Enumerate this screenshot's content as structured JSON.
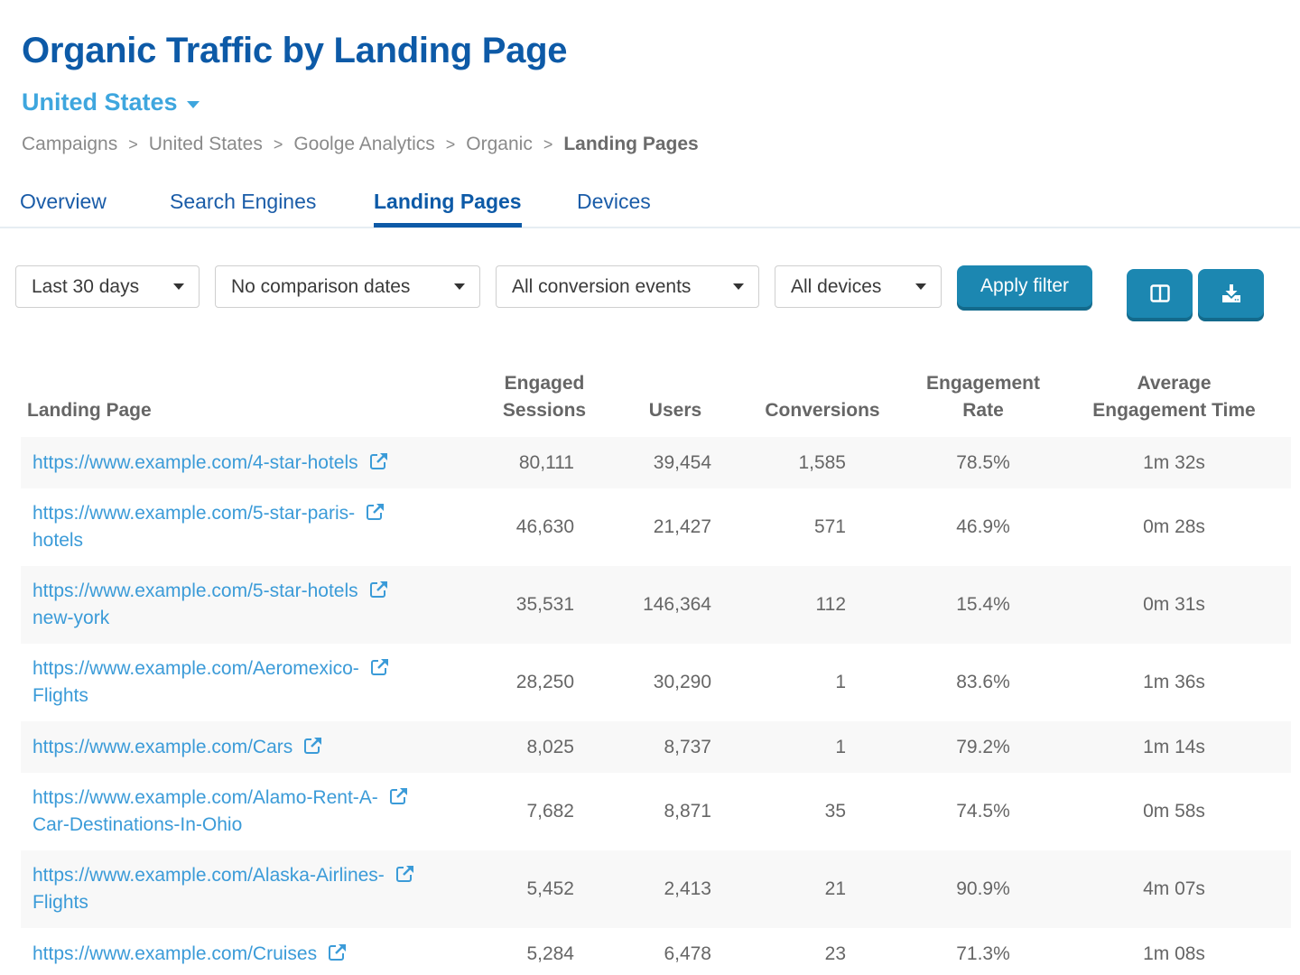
{
  "header": {
    "title": "Organic Traffic by Landing Page",
    "region": "United States"
  },
  "breadcrumb": [
    {
      "label": "Campaigns"
    },
    {
      "label": "United States"
    },
    {
      "label": "Goolge Analytics"
    },
    {
      "label": "Organic"
    },
    {
      "label": "Landing Pages"
    }
  ],
  "breadcrumb_separator": ">",
  "tabs": [
    {
      "label": "Overview",
      "active": false
    },
    {
      "label": "Search Engines",
      "active": false
    },
    {
      "label": "Landing Pages",
      "active": true
    },
    {
      "label": "Devices",
      "active": false
    }
  ],
  "filters": {
    "date_range": "Last 30 days",
    "comparison": "No comparison dates",
    "conversion_events": "All conversion events",
    "devices": "All devices",
    "apply_label": "Apply filter",
    "columns_icon": "columns-icon",
    "download_icon": "download-icon"
  },
  "colors": {
    "title": "#0d5aa7",
    "accent": "#3ea6de",
    "link": "#3b9bd8",
    "button": "#1c87b1"
  },
  "table": {
    "columns": {
      "landing_page": "Landing Page",
      "engaged_sessions_1": "Engaged",
      "engaged_sessions_2": "Sessions",
      "users": "Users",
      "conversions": "Conversions",
      "engagement_rate_1": "Engagement",
      "engagement_rate_2": "Rate",
      "avg_time_1": "Average",
      "avg_time_2": "Engagement Time"
    },
    "rows": [
      {
        "url_line1": "https://www.example.com/4-star-hotels",
        "url_line2": "",
        "engaged_sessions": "80,111",
        "users": "39,454",
        "conversions": "1,585",
        "engagement_rate": "78.5%",
        "avg_time": "1m 32s"
      },
      {
        "url_line1": "https://www.example.com/5-star-paris-",
        "url_line2": "hotels",
        "engaged_sessions": "46,630",
        "users": "21,427",
        "conversions": "571",
        "engagement_rate": "46.9%",
        "avg_time": "0m 28s"
      },
      {
        "url_line1": "https://www.example.com/5-star-hotels",
        "url_line2": "new-york",
        "engaged_sessions": "35,531",
        "users": "146,364",
        "conversions": "112",
        "engagement_rate": "15.4%",
        "avg_time": "0m 31s"
      },
      {
        "url_line1": "https://www.example.com/Aeromexico-",
        "url_line2": "Flights",
        "engaged_sessions": "28,250",
        "users": "30,290",
        "conversions": "1",
        "engagement_rate": "83.6%",
        "avg_time": "1m 36s"
      },
      {
        "url_line1": "https://www.example.com/Cars",
        "url_line2": "",
        "engaged_sessions": "8,025",
        "users": "8,737",
        "conversions": "1",
        "engagement_rate": "79.2%",
        "avg_time": "1m 14s"
      },
      {
        "url_line1": "https://www.example.com/Alamo-Rent-A-",
        "url_line2": "Car-Destinations-In-Ohio",
        "engaged_sessions": "7,682",
        "users": "8,871",
        "conversions": "35",
        "engagement_rate": "74.5%",
        "avg_time": "0m 58s"
      },
      {
        "url_line1": "https://www.example.com/Alaska-Airlines-",
        "url_line2": "Flights",
        "engaged_sessions": "5,452",
        "users": "2,413",
        "conversions": "21",
        "engagement_rate": "90.9%",
        "avg_time": "4m 07s"
      },
      {
        "url_line1": "https://www.example.com/Cruises",
        "url_line2": "",
        "engaged_sessions": "5,284",
        "users": "6,478",
        "conversions": "23",
        "engagement_rate": "71.3%",
        "avg_time": "1m 08s"
      }
    ]
  }
}
